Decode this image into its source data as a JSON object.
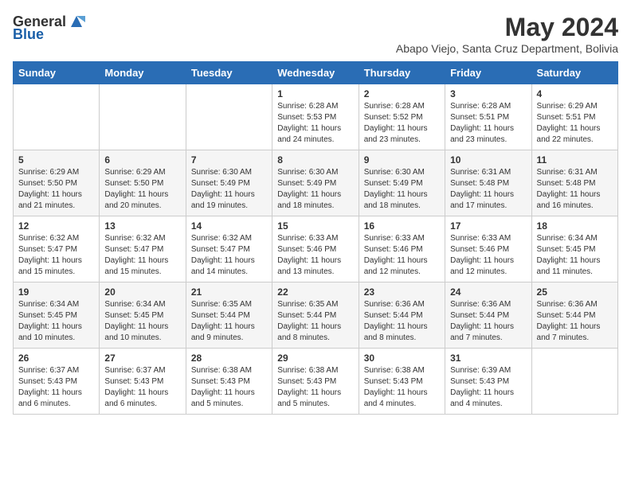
{
  "logo": {
    "general": "General",
    "blue": "Blue"
  },
  "title": "May 2024",
  "location": "Abapo Viejo, Santa Cruz Department, Bolivia",
  "days_of_week": [
    "Sunday",
    "Monday",
    "Tuesday",
    "Wednesday",
    "Thursday",
    "Friday",
    "Saturday"
  ],
  "weeks": [
    [
      {
        "day": "",
        "detail": ""
      },
      {
        "day": "",
        "detail": ""
      },
      {
        "day": "",
        "detail": ""
      },
      {
        "day": "1",
        "detail": "Sunrise: 6:28 AM\nSunset: 5:53 PM\nDaylight: 11 hours and 24 minutes."
      },
      {
        "day": "2",
        "detail": "Sunrise: 6:28 AM\nSunset: 5:52 PM\nDaylight: 11 hours and 23 minutes."
      },
      {
        "day": "3",
        "detail": "Sunrise: 6:28 AM\nSunset: 5:51 PM\nDaylight: 11 hours and 23 minutes."
      },
      {
        "day": "4",
        "detail": "Sunrise: 6:29 AM\nSunset: 5:51 PM\nDaylight: 11 hours and 22 minutes."
      }
    ],
    [
      {
        "day": "5",
        "detail": "Sunrise: 6:29 AM\nSunset: 5:50 PM\nDaylight: 11 hours and 21 minutes."
      },
      {
        "day": "6",
        "detail": "Sunrise: 6:29 AM\nSunset: 5:50 PM\nDaylight: 11 hours and 20 minutes."
      },
      {
        "day": "7",
        "detail": "Sunrise: 6:30 AM\nSunset: 5:49 PM\nDaylight: 11 hours and 19 minutes."
      },
      {
        "day": "8",
        "detail": "Sunrise: 6:30 AM\nSunset: 5:49 PM\nDaylight: 11 hours and 18 minutes."
      },
      {
        "day": "9",
        "detail": "Sunrise: 6:30 AM\nSunset: 5:49 PM\nDaylight: 11 hours and 18 minutes."
      },
      {
        "day": "10",
        "detail": "Sunrise: 6:31 AM\nSunset: 5:48 PM\nDaylight: 11 hours and 17 minutes."
      },
      {
        "day": "11",
        "detail": "Sunrise: 6:31 AM\nSunset: 5:48 PM\nDaylight: 11 hours and 16 minutes."
      }
    ],
    [
      {
        "day": "12",
        "detail": "Sunrise: 6:32 AM\nSunset: 5:47 PM\nDaylight: 11 hours and 15 minutes."
      },
      {
        "day": "13",
        "detail": "Sunrise: 6:32 AM\nSunset: 5:47 PM\nDaylight: 11 hours and 15 minutes."
      },
      {
        "day": "14",
        "detail": "Sunrise: 6:32 AM\nSunset: 5:47 PM\nDaylight: 11 hours and 14 minutes."
      },
      {
        "day": "15",
        "detail": "Sunrise: 6:33 AM\nSunset: 5:46 PM\nDaylight: 11 hours and 13 minutes."
      },
      {
        "day": "16",
        "detail": "Sunrise: 6:33 AM\nSunset: 5:46 PM\nDaylight: 11 hours and 12 minutes."
      },
      {
        "day": "17",
        "detail": "Sunrise: 6:33 AM\nSunset: 5:46 PM\nDaylight: 11 hours and 12 minutes."
      },
      {
        "day": "18",
        "detail": "Sunrise: 6:34 AM\nSunset: 5:45 PM\nDaylight: 11 hours and 11 minutes."
      }
    ],
    [
      {
        "day": "19",
        "detail": "Sunrise: 6:34 AM\nSunset: 5:45 PM\nDaylight: 11 hours and 10 minutes."
      },
      {
        "day": "20",
        "detail": "Sunrise: 6:34 AM\nSunset: 5:45 PM\nDaylight: 11 hours and 10 minutes."
      },
      {
        "day": "21",
        "detail": "Sunrise: 6:35 AM\nSunset: 5:44 PM\nDaylight: 11 hours and 9 minutes."
      },
      {
        "day": "22",
        "detail": "Sunrise: 6:35 AM\nSunset: 5:44 PM\nDaylight: 11 hours and 8 minutes."
      },
      {
        "day": "23",
        "detail": "Sunrise: 6:36 AM\nSunset: 5:44 PM\nDaylight: 11 hours and 8 minutes."
      },
      {
        "day": "24",
        "detail": "Sunrise: 6:36 AM\nSunset: 5:44 PM\nDaylight: 11 hours and 7 minutes."
      },
      {
        "day": "25",
        "detail": "Sunrise: 6:36 AM\nSunset: 5:44 PM\nDaylight: 11 hours and 7 minutes."
      }
    ],
    [
      {
        "day": "26",
        "detail": "Sunrise: 6:37 AM\nSunset: 5:43 PM\nDaylight: 11 hours and 6 minutes."
      },
      {
        "day": "27",
        "detail": "Sunrise: 6:37 AM\nSunset: 5:43 PM\nDaylight: 11 hours and 6 minutes."
      },
      {
        "day": "28",
        "detail": "Sunrise: 6:38 AM\nSunset: 5:43 PM\nDaylight: 11 hours and 5 minutes."
      },
      {
        "day": "29",
        "detail": "Sunrise: 6:38 AM\nSunset: 5:43 PM\nDaylight: 11 hours and 5 minutes."
      },
      {
        "day": "30",
        "detail": "Sunrise: 6:38 AM\nSunset: 5:43 PM\nDaylight: 11 hours and 4 minutes."
      },
      {
        "day": "31",
        "detail": "Sunrise: 6:39 AM\nSunset: 5:43 PM\nDaylight: 11 hours and 4 minutes."
      },
      {
        "day": "",
        "detail": ""
      }
    ]
  ]
}
